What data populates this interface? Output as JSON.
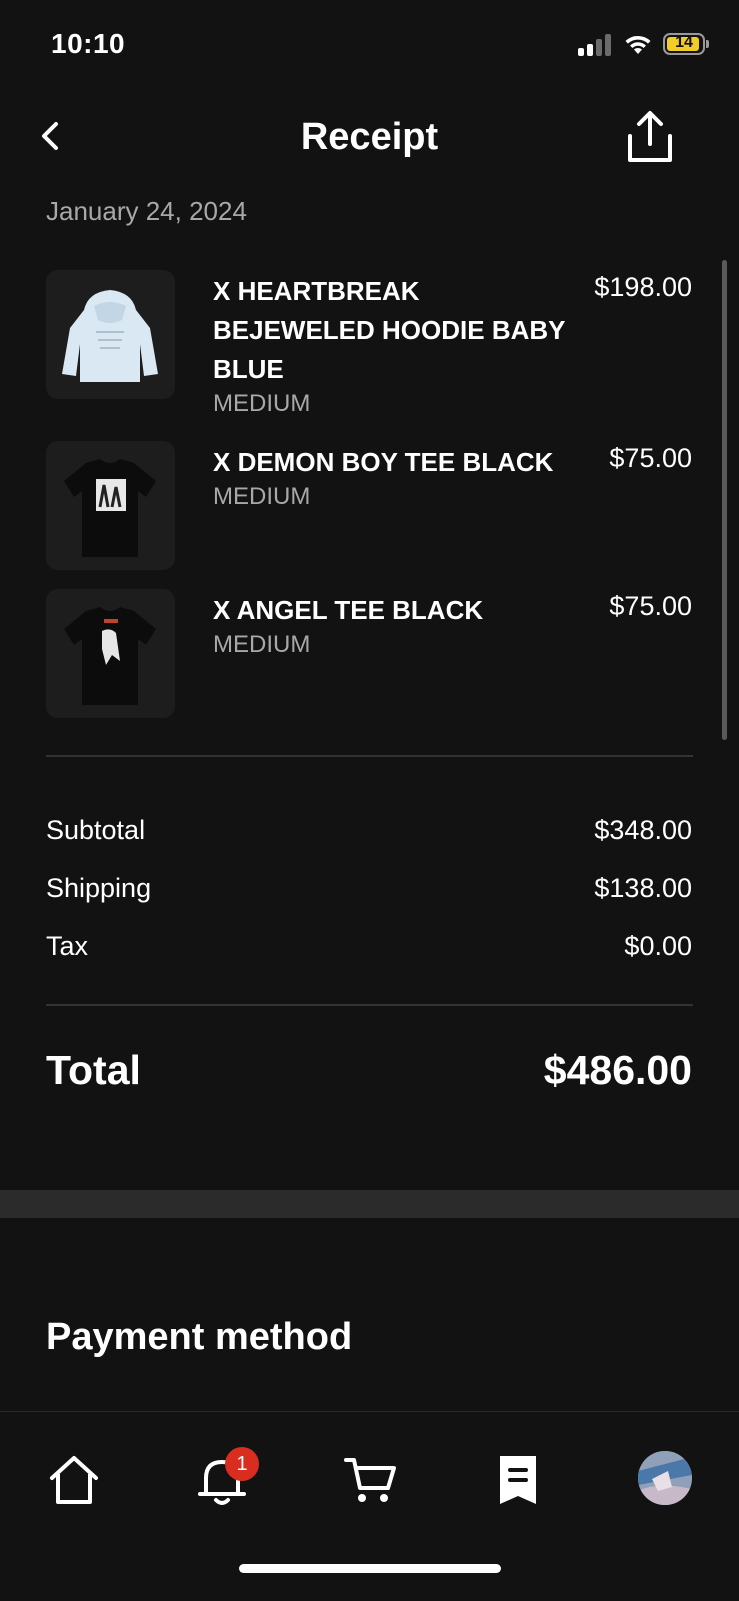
{
  "status_bar": {
    "time": "10:10",
    "battery": "14"
  },
  "header": {
    "title": "Receipt",
    "back_icon": "chevron-left-icon",
    "share_icon": "share-icon"
  },
  "order_date": "January 24, 2024",
  "items": [
    {
      "name": "X HEARTBREAK BEJEWELED HOODIE BABY BLUE",
      "size": "MEDIUM",
      "price": "$198.00",
      "image": "light-blue-hoodie"
    },
    {
      "name": "X DEMON BOY TEE BLACK",
      "size": "MEDIUM",
      "price": "$75.00",
      "image": "black-tee-graphic"
    },
    {
      "name": "X ANGEL TEE BLACK",
      "size": "MEDIUM",
      "price": "$75.00",
      "image": "black-tee-angel"
    }
  ],
  "summary": {
    "subtotal_label": "Subtotal",
    "subtotal": "$348.00",
    "shipping_label": "Shipping",
    "shipping": "$138.00",
    "tax_label": "Tax",
    "tax": "$0.00"
  },
  "total": {
    "label": "Total",
    "value": "$486.00"
  },
  "payment": {
    "title": "Payment method"
  },
  "tabbar": {
    "tabs": [
      "home-icon",
      "bell-icon",
      "cart-icon",
      "receipt-icon",
      "avatar"
    ],
    "notification_count": "1"
  },
  "colors": {
    "background": "#121212",
    "secondary_text": "#a8a8a8",
    "badge": "#d92d20",
    "battery": "#f2cc27"
  }
}
